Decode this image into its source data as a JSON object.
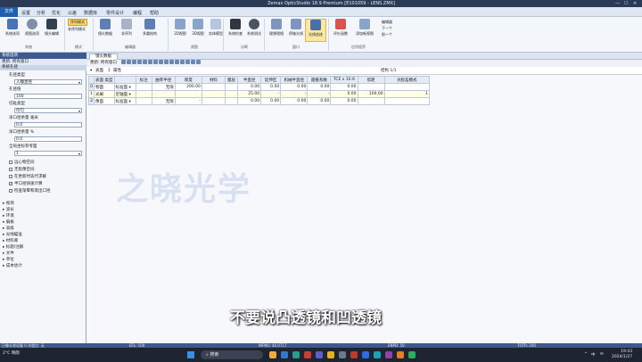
{
  "window": {
    "title": "Zemax OpticStudio 18.9   Premium   [E101059 - LENS.ZMX]",
    "controls": [
      "—",
      "☐",
      "✕"
    ]
  },
  "menu": {
    "file": "文件",
    "items": [
      "设置",
      "分析",
      "优化",
      "公差",
      "数据库",
      "零件设计",
      "编程",
      "帮助"
    ]
  },
  "ribbon": {
    "buttons": [
      {
        "label": "系统选项",
        "icon": "settings-icon"
      },
      {
        "label": "视图选项",
        "icon": "gear-icon"
      },
      {
        "label": "镜头编辑",
        "icon": "lens-icon"
      },
      {
        "label": "镜头数据",
        "icon": "table-icon"
      },
      {
        "label": "非序列",
        "icon": "table-icon"
      },
      {
        "label": "多重结构",
        "icon": "table-icon"
      },
      {
        "label": "2D视图",
        "icon": "layout-icon"
      },
      {
        "label": "3D视图",
        "icon": "layout-icon"
      },
      {
        "label": "实体模型",
        "icon": "solid-icon"
      },
      {
        "label": "系统检查",
        "icon": "traffic-light-icon"
      },
      {
        "label": "系统测试",
        "icon": "gauge-icon"
      },
      {
        "label": "理想透镜",
        "icon": "grid-icon"
      },
      {
        "label": "傍轴光线",
        "icon": "grid-icon"
      },
      {
        "label": "光线追迹",
        "icon": "ray-icon"
      },
      {
        "label": "评价函数",
        "icon": "chart-icon"
      },
      {
        "label": "添加新视图",
        "icon": "add-icon"
      }
    ],
    "small": [
      "序列模式",
      "非序列模式",
      "编辑器",
      "下一个",
      "前一个"
    ],
    "groups": [
      "系统",
      "模式",
      "编辑器",
      "视图",
      "诊断",
      "窗口",
      "应用程序"
    ]
  },
  "left_panel": {
    "header": "系统选项",
    "toolbar": "更新: 所有窗口",
    "section": "系统孔径",
    "fields": [
      {
        "label": "孔径类型",
        "value": "入瞳直径",
        "dropdown": true
      },
      {
        "label": "孔径值",
        "value": "100",
        "dropdown": false
      },
      {
        "label": "切趾类型",
        "value": "均匀",
        "dropdown": true
      },
      {
        "label": "净口径余量 毫米",
        "value": "0.0",
        "dropdown": false
      },
      {
        "label": "净口径余量 %",
        "value": "0.0",
        "dropdown": false
      },
      {
        "label": "全局坐标参考面",
        "value": "1",
        "dropdown": true
      }
    ],
    "checks": [
      {
        "label": "远心物空间",
        "checked": false
      },
      {
        "label": "无焦像空间",
        "checked": false
      },
      {
        "label": "在更新时迭代求解",
        "checked": false
      },
      {
        "label": "半口径快速计算",
        "checked": true
      },
      {
        "label": "检查渐晕和渐出口径",
        "checked": false
      }
    ],
    "tree": [
      "视场",
      "波长",
      "环境",
      "偏振",
      "高级",
      "光线瞄准",
      "材料库",
      "标题/注解",
      "文件",
      "单位",
      "成本估计"
    ]
  },
  "editor": {
    "tab": "镜头数据",
    "update": "更新: 所有窗口",
    "surface_label": "表面",
    "surface_num": "1",
    "surface_prop": "属性",
    "config": "结构 1/1",
    "columns": [
      "表面 类型",
      "标注",
      "曲率半径",
      "厚度",
      "材料",
      "膜层",
      "半直径",
      "延伸区",
      "机械半直径",
      "圆锥系数",
      "TCE x 1E-6",
      "焦距",
      "光程差模式"
    ],
    "rows": [
      {
        "idx": "0",
        "name": "物面",
        "type": "标准面",
        "comment": "",
        "radius": "无限",
        "thick": "200.00",
        "mat": "",
        "coat": "",
        "semi": "0.00",
        "chip": "0.00",
        "mech": "0.00",
        "conic": "0.00",
        "tce": "0.00",
        "focal": "",
        "opd": ""
      },
      {
        "idx": "1",
        "name": "光阑",
        "type": "近轴面",
        "comment": "",
        "radius": "",
        "thick": "200.00 M",
        "mat": "",
        "coat": "",
        "semi": "25.00",
        "chip": "-",
        "mech": "-",
        "conic": "-",
        "tce": "0.00",
        "focal": "100.00",
        "opd": "1"
      },
      {
        "idx": "2",
        "name": "像面",
        "type": "标准面",
        "comment": "",
        "radius": "无限",
        "thick": "-",
        "mat": "",
        "coat": "",
        "semi": "0.00",
        "chip": "0.00",
        "mech": "0.00",
        "conic": "0.00",
        "tce": "0.00",
        "focal": "",
        "opd": ""
      }
    ]
  },
  "overlay": {
    "watermark": "之晓光学",
    "subtitle": "不要说凸透镜和凹透镜"
  },
  "status": [
    "已像头状况复  0  光程比: 无",
    "EFL: 100",
    "WFNO: 40.0717",
    "ENPD: 50",
    "TOTR: 200"
  ],
  "taskbar": {
    "weather_temp": "2°C",
    "weather_text": "晴朗",
    "search": "搜索",
    "time": "19:43",
    "date": "2024/1/27",
    "tray": [
      "^",
      "中",
      "✉"
    ]
  }
}
